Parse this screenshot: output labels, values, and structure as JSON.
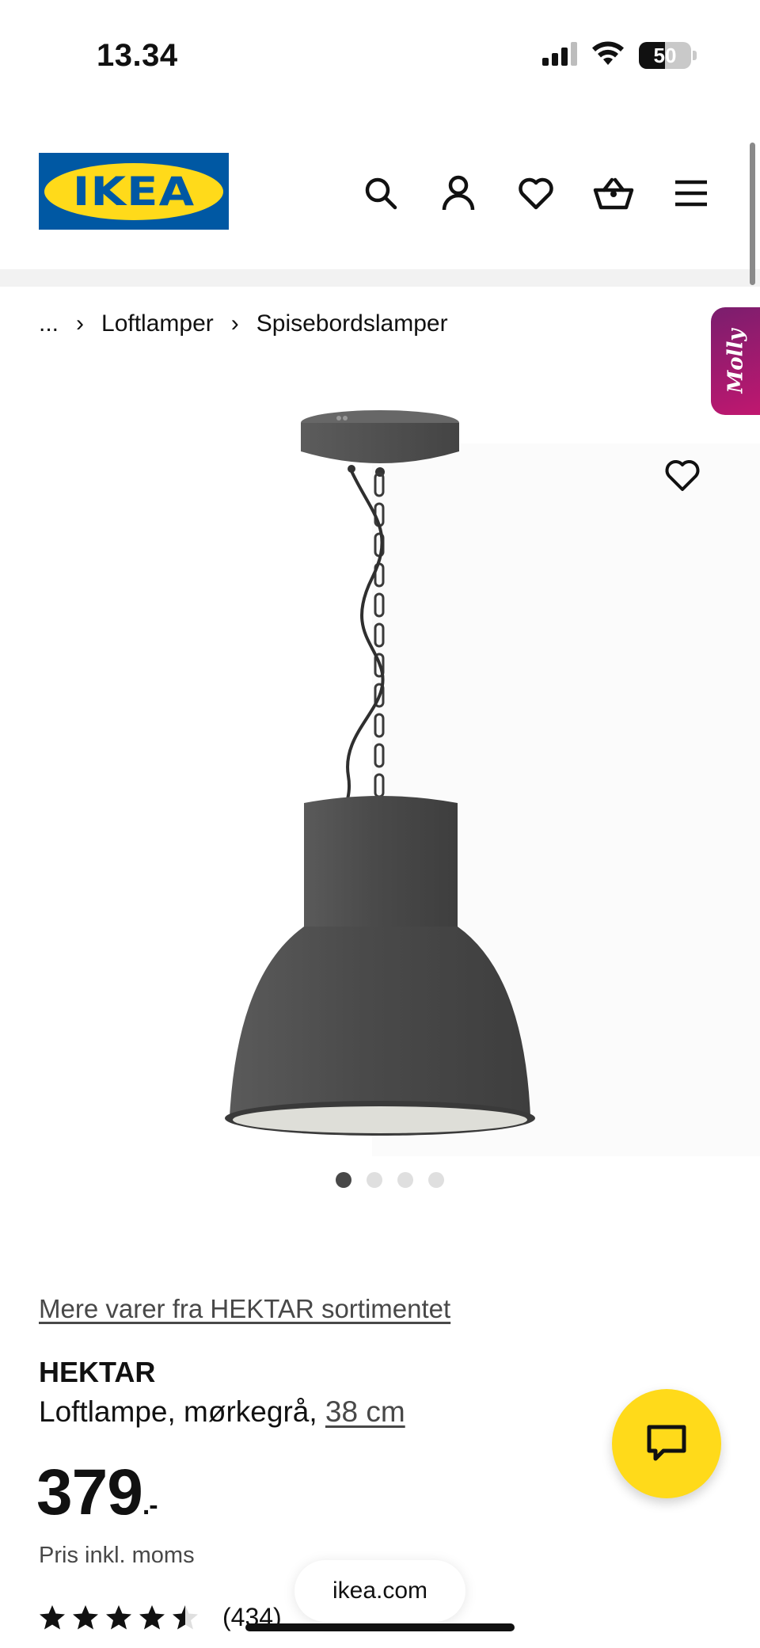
{
  "status_bar": {
    "time": "13.34",
    "battery_level": "50",
    "battery_fraction": 0.5,
    "icons": [
      "signal-icon",
      "wifi-icon",
      "battery-icon"
    ]
  },
  "header": {
    "logo_text": "IKEA",
    "icons": [
      "search-icon",
      "account-icon",
      "heart-icon",
      "basket-icon",
      "menu-icon"
    ],
    "brand_blue": "#0058a3",
    "brand_yellow": "#ffda1a"
  },
  "breadcrumb": {
    "items": [
      "...",
      "Loftlamper",
      "Spisebordslamper"
    ],
    "separator": "›"
  },
  "molly": {
    "label": "Molly",
    "color": "#b0176f"
  },
  "gallery": {
    "total_images": 4,
    "active_index": 0
  },
  "product": {
    "range_link": "Mere varer fra HEKTAR sortimentet",
    "name": "HEKTAR",
    "description": "Loftlampe, mørkegrå,",
    "size": "38 cm",
    "price": "379",
    "price_suffix": ".-",
    "price_note": "Pris inkl. moms",
    "rating": 4.5,
    "rating_count": "(434)"
  },
  "browser": {
    "url": "ikea.com"
  }
}
